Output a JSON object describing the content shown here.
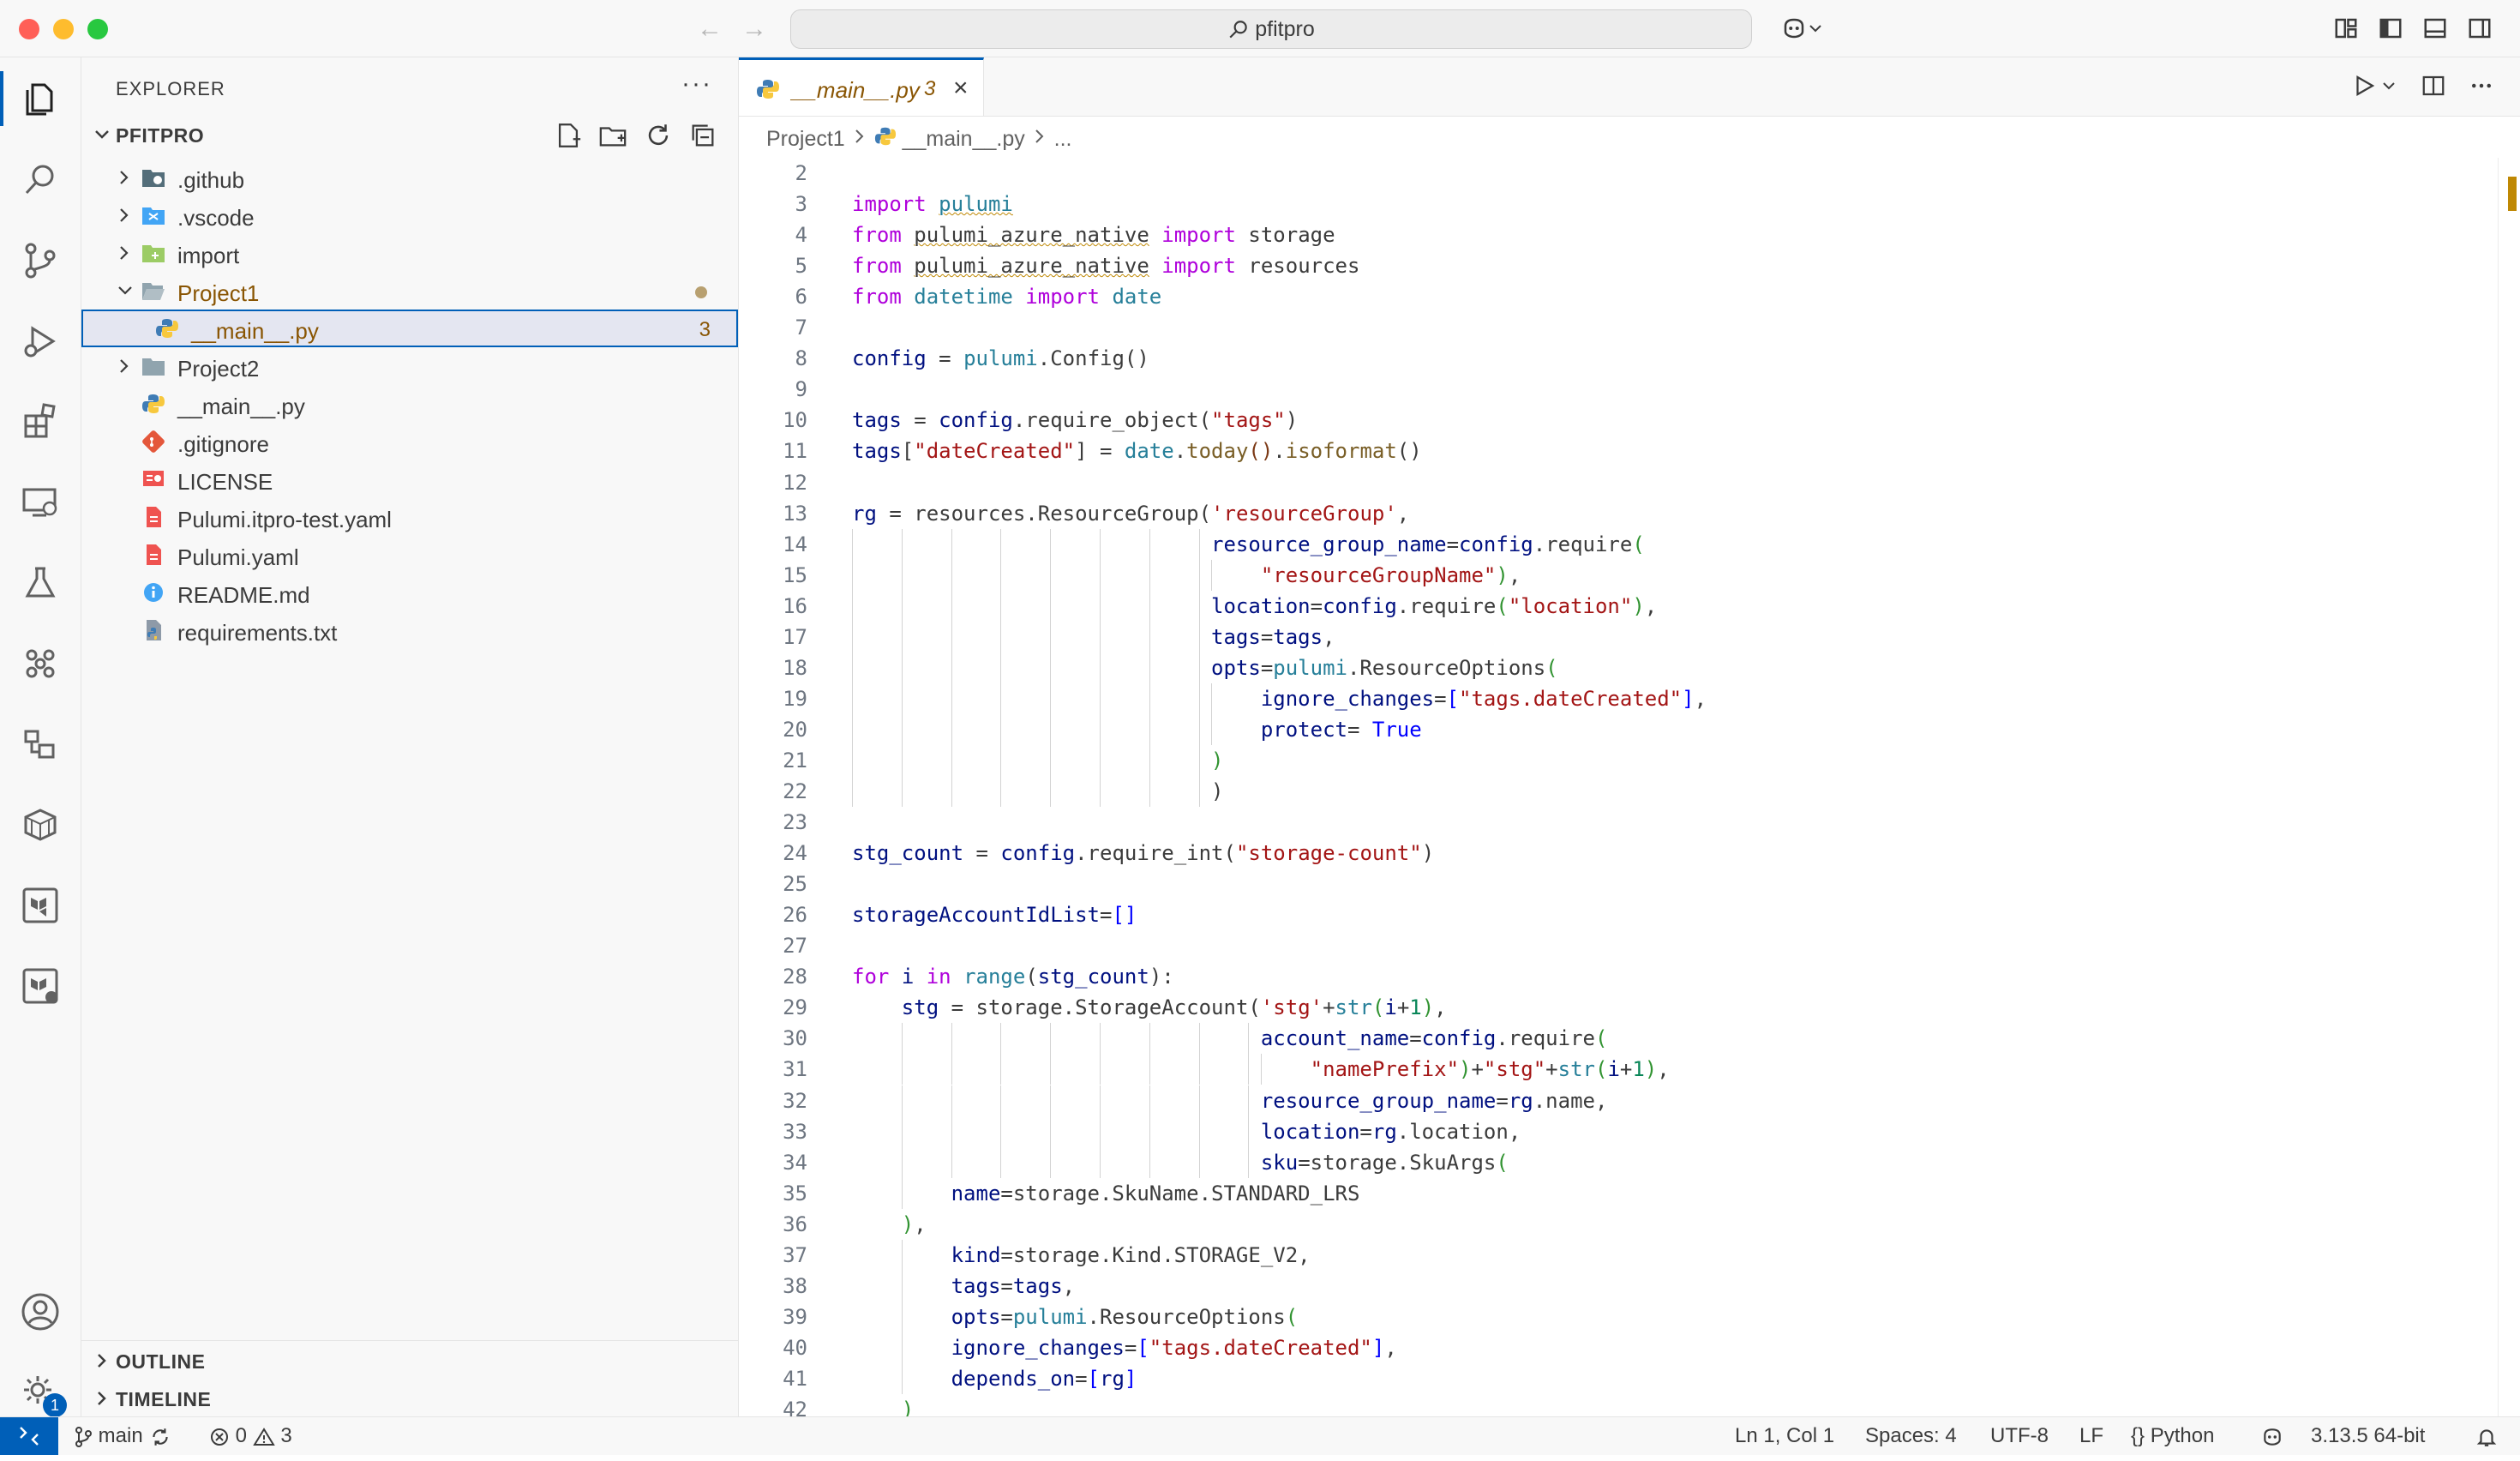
{
  "titlebar": {
    "search_text": "pfitpro",
    "back_icon": "arrow-left-icon",
    "forward_icon": "arrow-right-icon"
  },
  "activity_bar": {
    "items": [
      "explorer-icon",
      "search-icon",
      "source-control-icon",
      "run-debug-icon",
      "extensions-icon",
      "remote-explorer-icon",
      "testing-icon",
      "pulumi-icon",
      "docker-icon",
      "containers-icon",
      "terraform-icon",
      "terraform-cloud-icon"
    ],
    "settings_badge": "1"
  },
  "sidebar": {
    "title": "EXPLORER",
    "more": "···",
    "project_label": "PFITPRO",
    "tree": [
      {
        "name": ".github",
        "type": "folder"
      },
      {
        "name": ".vscode",
        "type": "folder"
      },
      {
        "name": "import",
        "type": "folder"
      },
      {
        "name": "Project1",
        "type": "folder-open"
      },
      {
        "name": "__main__.py",
        "type": "python",
        "count": "3"
      },
      {
        "name": "Project2",
        "type": "folder"
      },
      {
        "name": "__main__.py",
        "type": "python"
      },
      {
        "name": ".gitignore",
        "type": "git"
      },
      {
        "name": "LICENSE",
        "type": "license"
      },
      {
        "name": "Pulumi.itpro-test.yaml",
        "type": "yaml"
      },
      {
        "name": "Pulumi.yaml",
        "type": "yaml"
      },
      {
        "name": "README.md",
        "type": "info"
      },
      {
        "name": "requirements.txt",
        "type": "txt"
      }
    ],
    "outline_label": "OUTLINE",
    "timeline_label": "TIMELINE"
  },
  "editor": {
    "tab": {
      "name": "__main__.py",
      "problems": "3",
      "close": "×"
    },
    "breadcrumb": {
      "folder": "Project1",
      "file": "__main__.py",
      "symbol": "..."
    }
  },
  "code_lines": [
    {
      "n": "2",
      "html": ""
    },
    {
      "n": "3",
      "html": "<span class='kw'>import</span> <span class='mod2 squig'>pulumi</span>"
    },
    {
      "n": "4",
      "html": "<span class='kw'>from</span> <span class='squig'>pulumi_azure_native</span> <span class='kw'>import</span> storage"
    },
    {
      "n": "5",
      "html": "<span class='kw'>from</span> <span class='squig'>pulumi_azure_native</span> <span class='kw'>import</span> resources"
    },
    {
      "n": "6",
      "html": "<span class='kw'>from</span> <span class='mod2'>datetime</span> <span class='kw'>import</span> <span class='mod2'>date</span>"
    },
    {
      "n": "7",
      "html": ""
    },
    {
      "n": "8",
      "html": "<span class='var'>config</span> = <span class='mod2'>pulumi</span>.Config()"
    },
    {
      "n": "9",
      "html": ""
    },
    {
      "n": "10",
      "html": "<span class='var'>tags</span> = <span class='var'>config</span>.require_object(<span class='str'>\"tags\"</span>)"
    },
    {
      "n": "11",
      "html": "<span class='var'>tags</span>[<span class='str'>\"dateCreated\"</span>] = <span class='mod2'>date</span>.<span class='fn'>today</span><span class='brk2'>()</span>.<span class='fn'>isoformat</span>()"
    },
    {
      "n": "12",
      "html": ""
    },
    {
      "n": "13",
      "html": "<span class='var'>rg</span> = resources.ResourceGroup(<span class='str'>'resourceGroup'</span>,"
    },
    {
      "n": "14",
      "html": "                             <span class='var'>resource_group_name</span>=<span class='var'>config</span>.require<span class='brk'>(</span>"
    },
    {
      "n": "15",
      "html": "                                 <span class='str'>\"resourceGroupName\"</span><span class='brk'>)</span>,"
    },
    {
      "n": "16",
      "html": "                             <span class='var'>location</span>=<span class='var'>config</span>.require<span class='brk'>(</span><span class='str'>\"location\"</span><span class='brk'>)</span>,"
    },
    {
      "n": "17",
      "html": "                             <span class='var'>tags</span>=<span class='var'>tags</span>,"
    },
    {
      "n": "18",
      "html": "                             <span class='var'>opts</span>=<span class='mod2'>pulumi</span>.ResourceOptions<span class='brk'>(</span>"
    },
    {
      "n": "19",
      "html": "                                 <span class='var'>ignore_changes</span>=<span class='bl'>[</span><span class='str'>\"tags.dateCreated\"</span><span class='bl'>]</span>,"
    },
    {
      "n": "20",
      "html": "                                 <span class='var'>protect</span>= <span class='bl'>True</span>"
    },
    {
      "n": "21",
      "html": "                             <span class='brk'>)</span>"
    },
    {
      "n": "22",
      "html": "                             )"
    },
    {
      "n": "23",
      "html": ""
    },
    {
      "n": "24",
      "html": "<span class='var'>stg_count</span> = <span class='var'>config</span>.require_int(<span class='str'>\"storage-count\"</span>)"
    },
    {
      "n": "25",
      "html": ""
    },
    {
      "n": "26",
      "html": "<span class='var'>storageAccountIdList</span>=<span class='bl'>[]</span>"
    },
    {
      "n": "27",
      "html": ""
    },
    {
      "n": "28",
      "html": "<span class='kw'>for</span> <span class='var'>i</span> <span class='kw'>in</span> <span class='mod2'>range</span>(<span class='var'>stg_count</span>):"
    },
    {
      "n": "29",
      "html": "    <span class='var'>stg</span> = storage.StorageAccount(<span class='str'>'stg'</span>+<span class='mod2'>str</span><span class='brk'>(</span><span class='var'>i</span>+<span class='num'>1</span><span class='brk'>)</span>,"
    },
    {
      "n": "30",
      "html": "                                 <span class='var'>account_name</span>=<span class='var'>config</span>.require<span class='brk'>(</span>"
    },
    {
      "n": "31",
      "html": "                                     <span class='str'>\"namePrefix\"</span><span class='brk'>)</span>+<span class='str'>\"stg\"</span>+<span class='mod2'>str</span><span class='brk'>(</span><span class='var'>i</span>+<span class='num'>1</span><span class='brk'>)</span>,"
    },
    {
      "n": "32",
      "html": "                                 <span class='var'>resource_group_name</span>=<span class='var'>rg</span>.name,"
    },
    {
      "n": "33",
      "html": "                                 <span class='var'>location</span>=<span class='var'>rg</span>.location,"
    },
    {
      "n": "34",
      "html": "                                 <span class='var'>sku</span>=storage.SkuArgs<span class='brk'>(</span>"
    },
    {
      "n": "35",
      "html": "        <span class='var'>name</span>=storage.SkuName.STANDARD_LRS"
    },
    {
      "n": "36",
      "html": "    <span class='brk'>)</span>,"
    },
    {
      "n": "37",
      "html": "        <span class='var'>kind</span>=storage.Kind.STORAGE_V2,"
    },
    {
      "n": "38",
      "html": "        <span class='var'>tags</span>=<span class='var'>tags</span>,"
    },
    {
      "n": "39",
      "html": "        <span class='var'>opts</span>=<span class='mod2'>pulumi</span>.ResourceOptions<span class='brk'>(</span>"
    },
    {
      "n": "40",
      "html": "        <span class='var'>ignore_changes</span>=<span class='bl'>[</span><span class='str'>\"tags.dateCreated\"</span><span class='bl'>]</span>,"
    },
    {
      "n": "41",
      "html": "        <span class='var'>depends_on</span>=<span class='bl'>[</span><span class='var'>rg</span><span class='bl'>]</span>"
    },
    {
      "n": "42",
      "html": "    <span class='brk'>)</span>"
    }
  ],
  "statusbar": {
    "branch": "main",
    "errors": "0",
    "warnings": "3",
    "position": "Ln 1, Col 1",
    "spaces": "Spaces: 4",
    "encoding": "UTF-8",
    "eol": "LF",
    "language": "Python",
    "interpreter": "3.13.5 64-bit"
  },
  "colors": {
    "accent": "#005fb8",
    "modified": "#895503",
    "keyword": "#af00db",
    "string": "#a31515",
    "type": "#267f99"
  }
}
